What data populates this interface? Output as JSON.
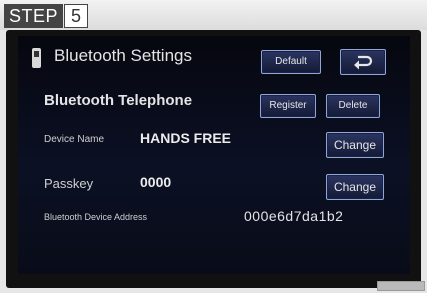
{
  "step": {
    "label": "STEP",
    "number": "5"
  },
  "screen": {
    "title": "Bluetooth Settings",
    "default_button": "Default",
    "back_icon": "return-arrow-icon",
    "subtitle": "Bluetooth Telephone",
    "register_button": "Register",
    "delete_button": "Delete",
    "device_name": {
      "label": "Device Name",
      "value": "HANDS FREE",
      "change_button": "Change"
    },
    "passkey": {
      "label": "Passkey",
      "value": "0000",
      "change_button": "Change"
    },
    "address": {
      "label": "Bluetooth Device Address",
      "value": "000e6d7da1b2"
    }
  },
  "colors": {
    "screen_bg": "#0b1024",
    "button_border": "#8fa6d6",
    "frame": "#111111"
  }
}
